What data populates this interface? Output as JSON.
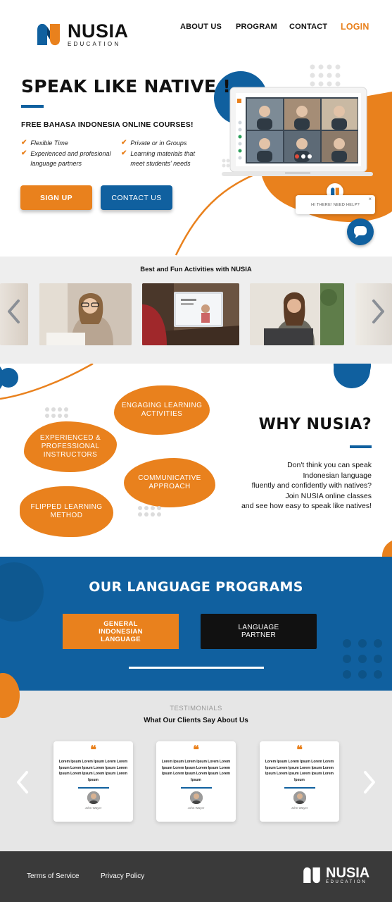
{
  "brand": {
    "name": "NUSIA",
    "tagline": "EDUCATION",
    "colors": {
      "orange": "#e9811d",
      "blue": "#10609f",
      "dark": "#3a3a3a"
    }
  },
  "nav": {
    "items": [
      "ABOUT US",
      "PROGRAM",
      "CONTACT"
    ],
    "login": "LOGIN"
  },
  "hero": {
    "title": "SPEAK LIKE NATIVE !",
    "subtitle": "FREE BAHASA INDONESIA ONLINE COURSES!",
    "features_left": [
      "Flexible Time",
      "Experienced and profesional",
      "language partners"
    ],
    "features_right": [
      "Private or in Groups",
      "Learning materials that",
      "meet students' needs"
    ],
    "signup": "SIGN UP",
    "contact": "CONTACT US"
  },
  "chat": {
    "bubble": "HI THERE! NEED HELP?",
    "close": "×"
  },
  "activities": {
    "title": "Best and Fun Activities with NUSIA"
  },
  "why": {
    "title": "WHY NUSIA?",
    "text": [
      "Don't think you can speak",
      "Indonesian language",
      "fluently and confidently with natives?",
      "Join NUSIA online classes",
      "and see how easy to speak like natives!"
    ],
    "blobs": {
      "engaging": "ENGAGING LEARNING ACTIVITIES",
      "experienced": "EXPERIENCED & PROFESSIONAL INSTRUCTORS",
      "communicative": "COMMUNICATIVE APPROACH",
      "flipped": "FLIPPED LEARNING METHOD"
    }
  },
  "programs": {
    "title": "OUR LANGUAGE PROGRAMS",
    "general": "GENERAL INDONESIAN LANGUAGE",
    "partner": "LANGUAGE PARTNER"
  },
  "testimonials": {
    "label": "TESTIMONIALS",
    "title": "What Our Clients Say About Us",
    "cards": [
      {
        "text": "Lorem Ipsum Lorem Ipsum Lorem Lorem Ipsum Lorem Ipsum Lorem Ipsum Lorem Ipsum Lorem Ipsum Lorem Ipsum Lorem Ipsum",
        "name": "John Wayer"
      },
      {
        "text": "Lorem Ipsum Lorem Ipsum Lorem Lorem Ipsum Lorem Ipsum Lorem Ipsum Lorem Ipsum Lorem Ipsum Lorem Ipsum Lorem Ipsum",
        "name": "John Wayer"
      },
      {
        "text": "Lorem Ipsum Lorem Ipsum Lorem Lorem Ipsum Lorem Ipsum Lorem Ipsum Lorem Ipsum Lorem Ipsum Lorem Ipsum Lorem Ipsum",
        "name": "John Wayer"
      }
    ]
  },
  "footer": {
    "terms": "Terms of Service",
    "privacy": "Privacy Policy"
  }
}
